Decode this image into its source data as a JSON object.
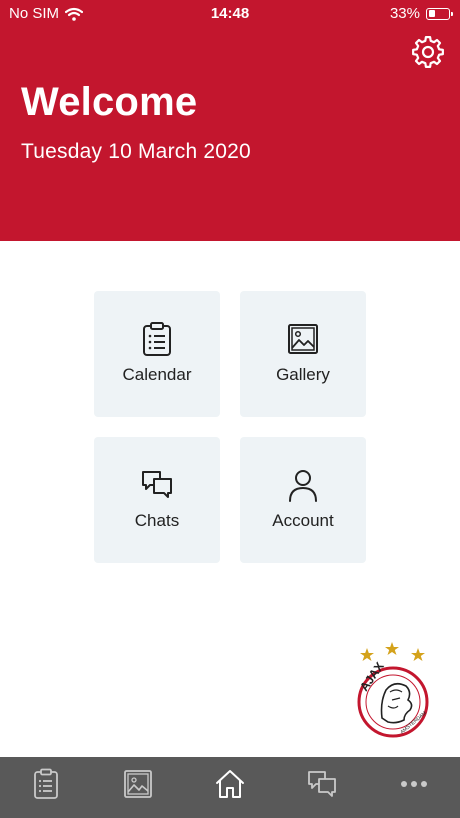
{
  "status_bar": {
    "carrier": "No SIM",
    "time": "14:48",
    "battery": "33%",
    "battery_level": 0.33
  },
  "header": {
    "title": "Welcome",
    "date": "Tuesday 10 March 2020",
    "settings_icon": "gear-icon"
  },
  "tiles": [
    {
      "label": "Calendar",
      "icon": "clipboard-icon"
    },
    {
      "label": "Gallery",
      "icon": "image-icon"
    },
    {
      "label": "Chats",
      "icon": "chat-icon"
    },
    {
      "label": "Account",
      "icon": "user-icon"
    }
  ],
  "logo": {
    "text": "AJAX",
    "subtext": "AMSTERDAM"
  },
  "tabbar": {
    "items": [
      {
        "icon": "clipboard-icon"
      },
      {
        "icon": "image-icon"
      },
      {
        "icon": "home-icon",
        "active": true
      },
      {
        "icon": "chat-icon"
      },
      {
        "icon": "more-icon"
      }
    ]
  },
  "colors": {
    "header": "#c3162e",
    "tile": "#eef3f6",
    "tabbar": "#595959",
    "tab_icon": "#c9c9c9",
    "tab_icon_active": "#ffffff"
  }
}
